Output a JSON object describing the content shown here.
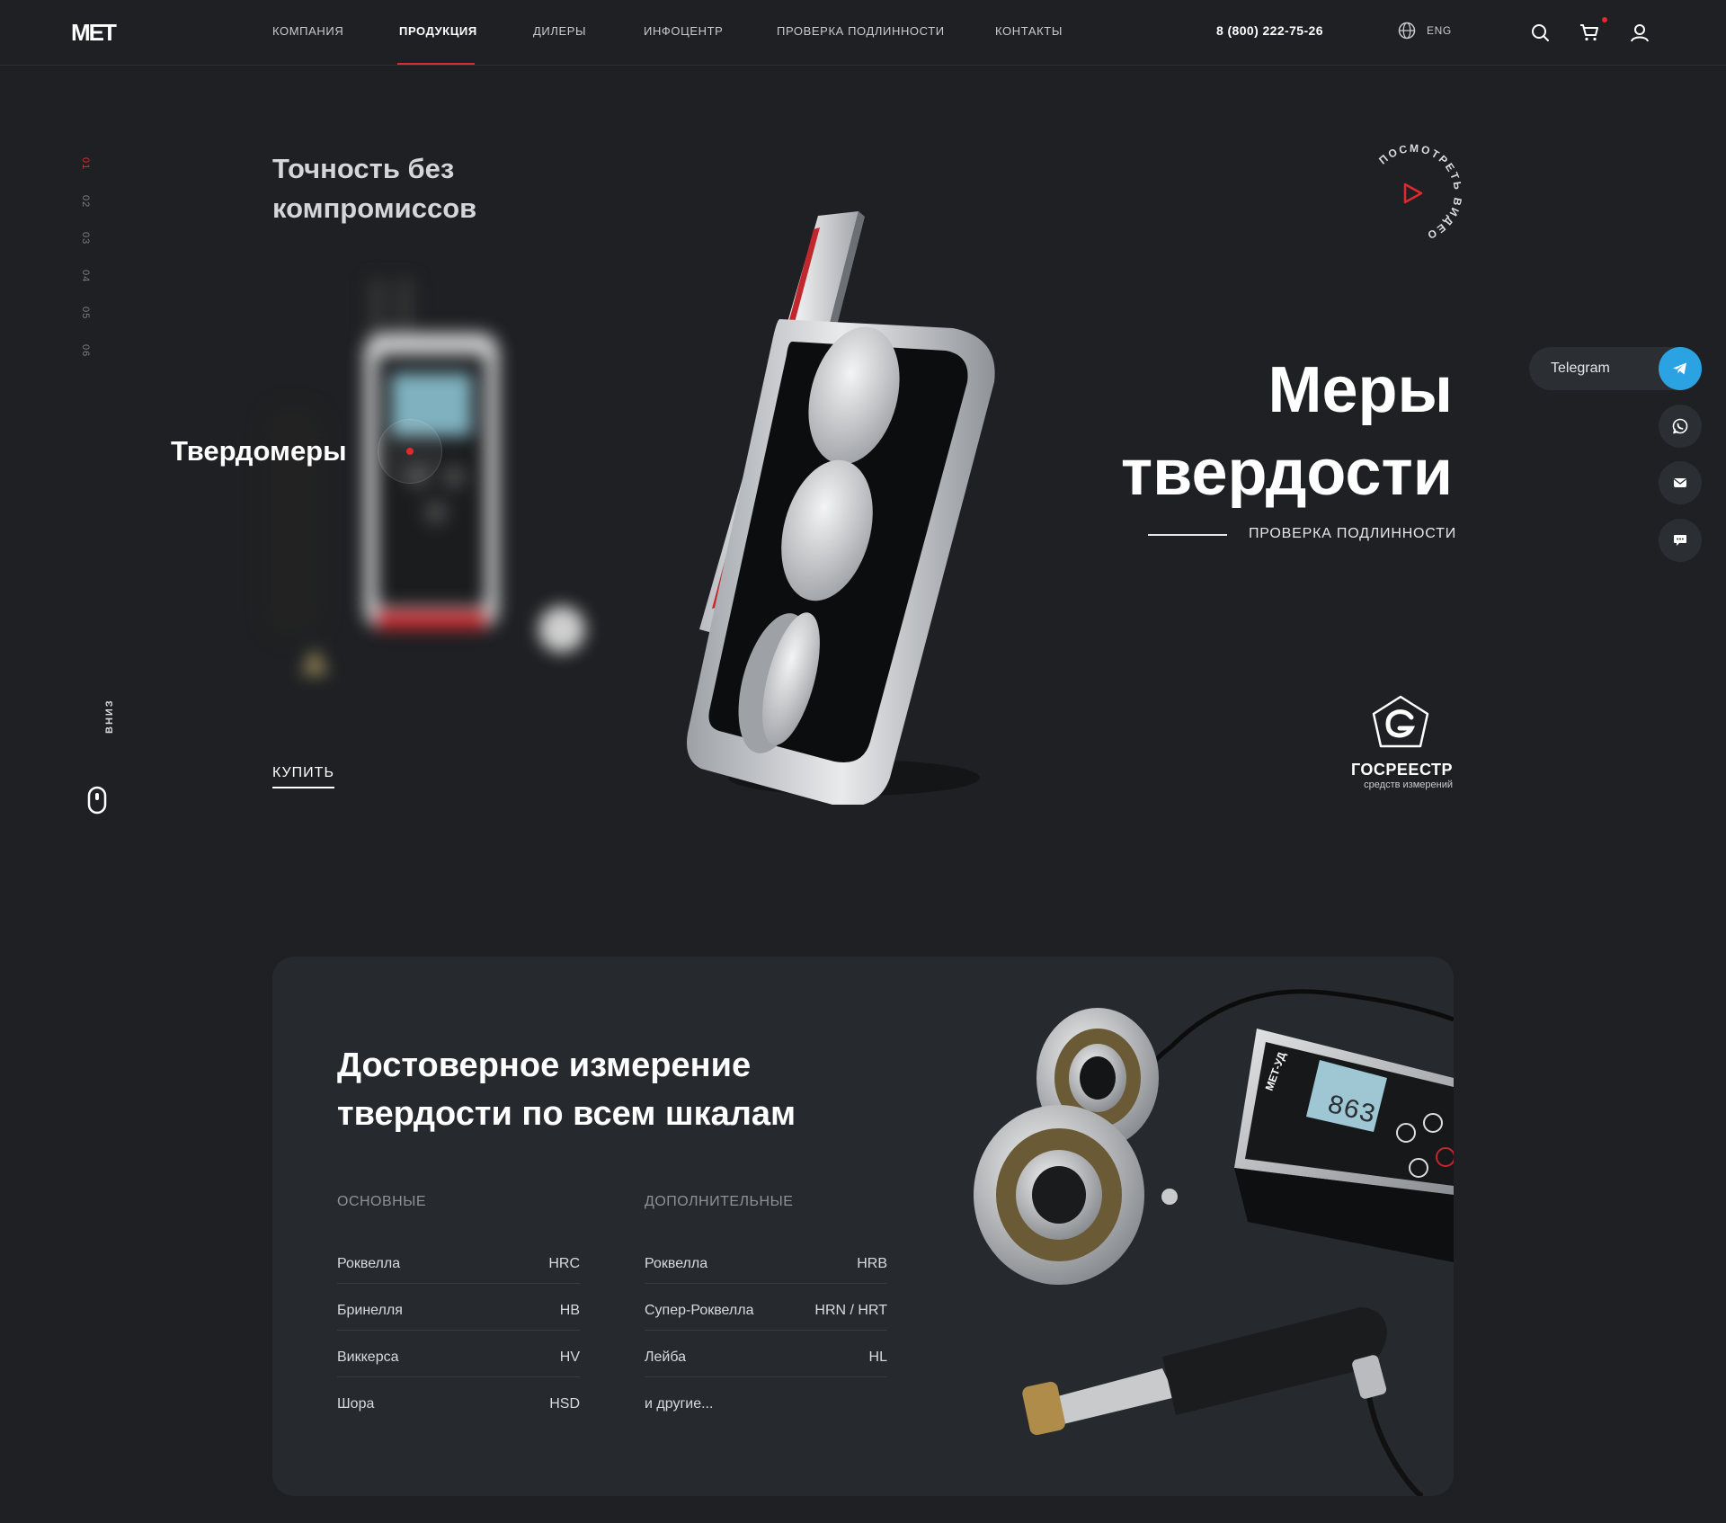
{
  "header": {
    "logo_text": "MET",
    "nav": [
      {
        "label": "КОМПАНИЯ"
      },
      {
        "label": "ПРОДУКЦИЯ"
      },
      {
        "label": "ДИЛЕРЫ"
      },
      {
        "label": "ИНФОЦЕНТР"
      },
      {
        "label": "ПРОВЕРКА ПОДЛИННОСТИ"
      },
      {
        "label": "КОНТАКТЫ"
      }
    ],
    "active_nav": "ПРОДУКЦИЯ",
    "phone": "8 (800) 222-75-26",
    "language": "ENG",
    "icons": [
      "globe-icon",
      "search-icon",
      "cart-icon",
      "user-icon"
    ],
    "cart_has_items": true
  },
  "slider": {
    "numbers": [
      "01",
      "02",
      "03",
      "04",
      "05",
      "06"
    ],
    "active": "01",
    "scroll_label": "ВНИЗ"
  },
  "hero": {
    "tagline": "Точность без компромиссов",
    "secondary_title": "Твердомеры",
    "title": "Меры твердости",
    "buy_label": "КУПИТЬ",
    "verify_label": "ПРОВЕРКА ПОДЛИННОСТИ",
    "video_label": "ПОСМОТРЕТЬ ВИДЕО",
    "gosreestr_title": "ГОСРЕЕСТР",
    "gosreestr_subtitle": "средств измерений"
  },
  "contacts": {
    "telegram_label": "Telegram",
    "icons": [
      "telegram-icon",
      "whatsapp-icon",
      "mail-icon",
      "chat-icon"
    ]
  },
  "scales": {
    "title": "Достоверное измерение твердости по всем шкалам",
    "main_heading": "ОСНОВНЫЕ",
    "extra_heading": "ДОПОЛНИТЕЛЬНЫЕ",
    "main": [
      {
        "name": "Роквелла",
        "code": "HRC"
      },
      {
        "name": "Бринелля",
        "code": "HB"
      },
      {
        "name": "Виккерса",
        "code": "HV"
      },
      {
        "name": "Шора",
        "code": "HSD"
      }
    ],
    "extra": [
      {
        "name": "Роквелла",
        "code": "HRB"
      },
      {
        "name": "Супер-Роквелла",
        "code": "HRN / HRT"
      },
      {
        "name": "Лейба",
        "code": "HL"
      },
      {
        "name": "и другие...",
        "code": ""
      }
    ],
    "photo_device_reading": "863",
    "photo_device_label": "МЕТ-УД"
  },
  "colors": {
    "background": "#1e2023",
    "card": "#26292d",
    "accent": "#e0292f",
    "telegram": "#2ba3e2"
  }
}
